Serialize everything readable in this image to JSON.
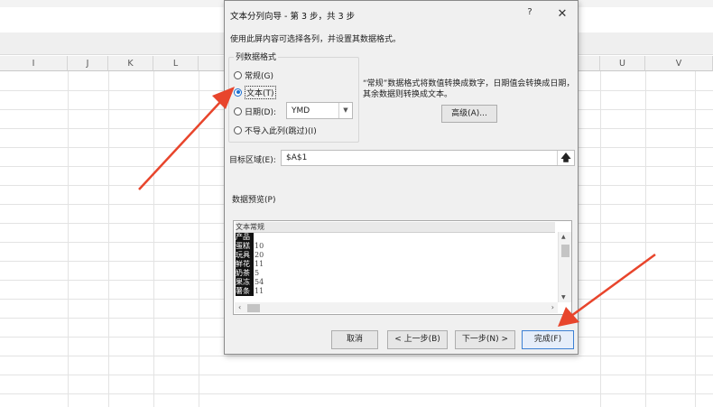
{
  "spreadsheet": {
    "columns": [
      {
        "label": "I"
      },
      {
        "label": "J"
      },
      {
        "label": "K"
      },
      {
        "label": "L"
      },
      {
        "label": "U"
      },
      {
        "label": "V"
      }
    ]
  },
  "dialog": {
    "title": "文本分列向导 - 第 3 步，共 3 步",
    "help": "?",
    "close": "✕",
    "instruction": "使用此屏内容可选择各列，并设置其数据格式。",
    "column_format": {
      "group_label": "列数据格式",
      "options": [
        {
          "label": "常规(G)",
          "checked": false
        },
        {
          "label": "文本(T)",
          "checked": true
        },
        {
          "label": "日期(D):",
          "checked": false
        },
        {
          "label": "不导入此列(跳过)(I)",
          "checked": false
        }
      ],
      "date_format": "YMD"
    },
    "description": "“常规”数据格式将数值转换成数字，日期值会转换成日期，其余数据则转换成文本。",
    "advanced_button": "高级(A)...",
    "destination": {
      "label": "目标区域(E):",
      "value": "$A$1",
      "collapse_icon": "🡅"
    },
    "preview": {
      "label": "数据预览(P)",
      "header": "文本常规",
      "rows": [
        {
          "c1": "产品",
          "c2": ""
        },
        {
          "c1": "蛋糕",
          "c2": "10"
        },
        {
          "c1": "玩具",
          "c2": "20"
        },
        {
          "c1": "鲜花",
          "c2": "11"
        },
        {
          "c1": "奶茶",
          "c2": "5"
        },
        {
          "c1": "果冻",
          "c2": "54"
        },
        {
          "c1": "薯条",
          "c2": "11"
        }
      ]
    },
    "buttons": {
      "cancel": "取消",
      "back": "< 上一步(B)",
      "next": "下一步(N) >",
      "finish": "完成(F)"
    }
  },
  "colors": {
    "annotation_arrow": "#e8452c",
    "accent": "#1b6fd1"
  }
}
